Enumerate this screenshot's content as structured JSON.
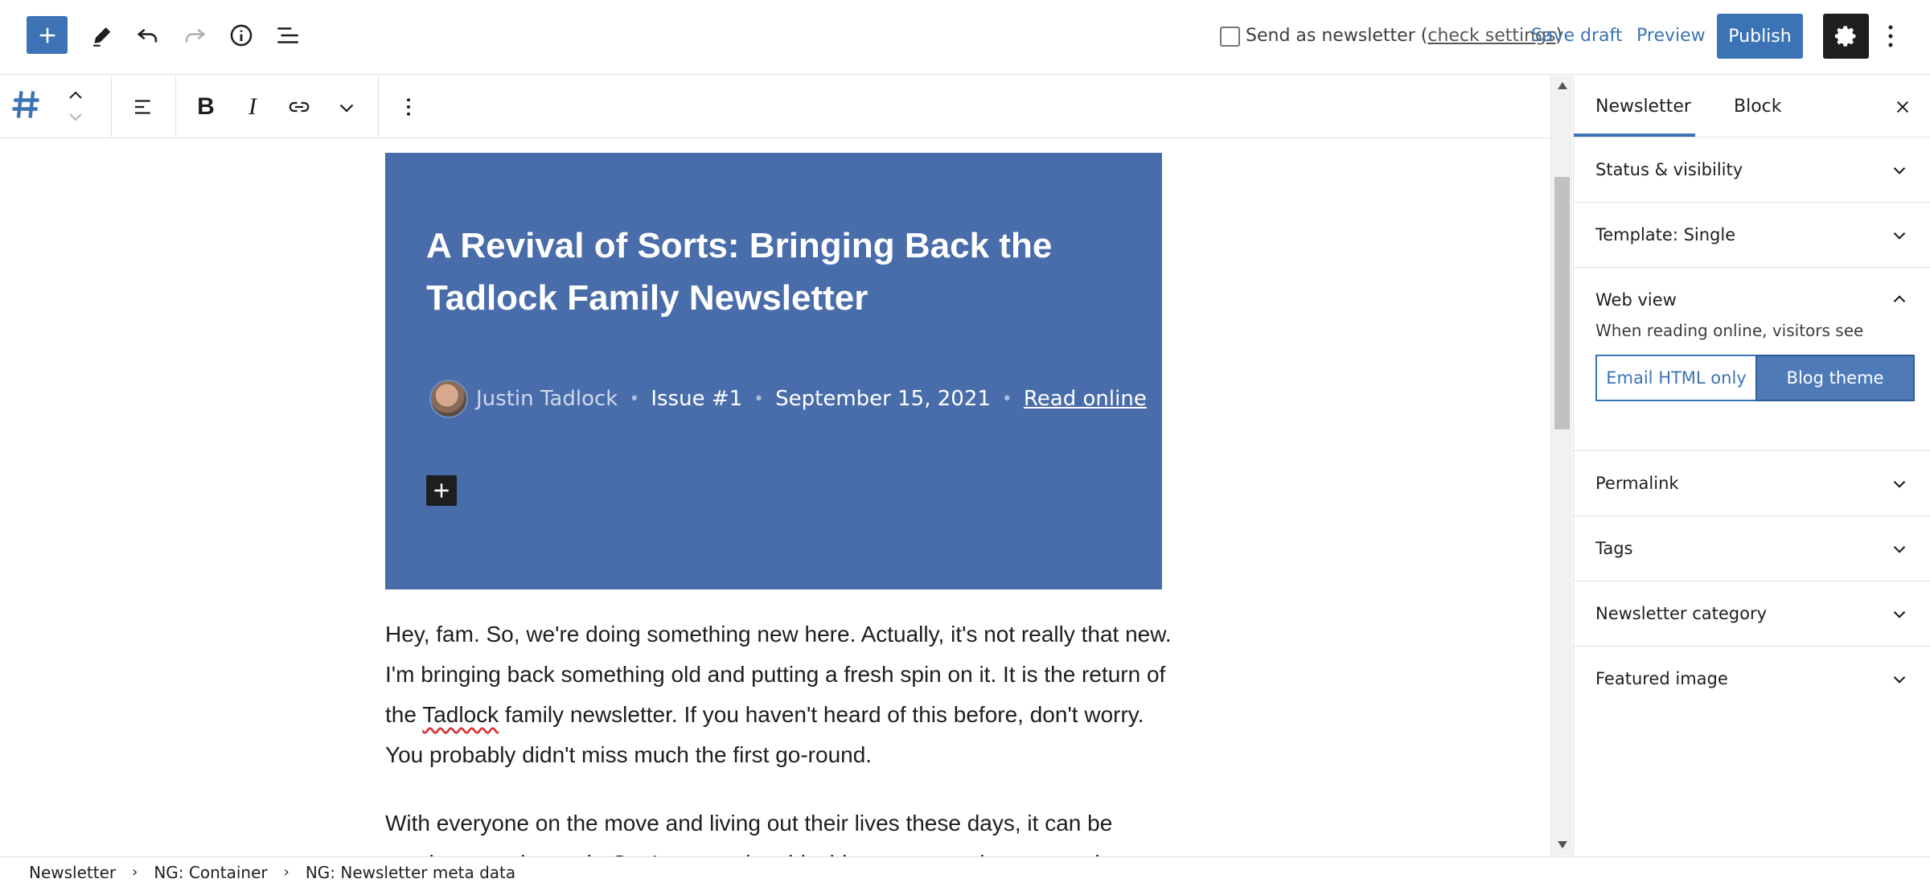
{
  "header": {
    "send_newsletter_label": "Send as newsletter",
    "check_settings_link": "check settings",
    "save_draft": "Save draft",
    "preview": "Preview",
    "publish": "Publish",
    "icons": [
      "plus-icon",
      "pencil-icon",
      "undo-icon",
      "redo-icon",
      "info-icon",
      "list-view-icon",
      "gear-icon",
      "more-vertical-icon"
    ]
  },
  "block_toolbar": {
    "icons": [
      "hash-icon",
      "move-up-icon",
      "move-down-icon",
      "align-left-icon",
      "bold-icon",
      "italic-icon",
      "link-icon",
      "chevron-down-icon",
      "more-vertical-icon"
    ],
    "bold_glyph": "B",
    "italic_glyph": "I"
  },
  "content": {
    "hero_title": "A Revival of Sorts: Bringing Back the Tadlock Family Newsletter",
    "author": "Justin Tadlock",
    "issue": "Issue #1",
    "date": "September 15, 2021",
    "read_online": "Read online",
    "separator": "•",
    "paragraph1_part1": "Hey, fam.  So, we're doing something new here.  Actually, it's not really that new.  I'm bringing back something old and putting a fresh spin on it.  It is the return of the ",
    "paragraph1_spell": "Tadlock",
    "paragraph1_part2": " family newsletter.  If you haven't heard of this before, don't worry.  You probably didn't miss much the first go-round.",
    "paragraph2": "With everyone on the move and living out their lives these days, it can be tough to stay in touch.  So, I am starting this thing as a way that we can keep",
    "hero_color": "#496caa"
  },
  "sidebar": {
    "tabs": [
      "Newsletter",
      "Block"
    ],
    "active_tab": "Newsletter",
    "panels": [
      {
        "title": "Status & visibility",
        "expanded": false
      },
      {
        "title": "Template: Single",
        "expanded": false
      },
      {
        "title": "Web view",
        "expanded": true
      },
      {
        "title": "Permalink",
        "expanded": false
      },
      {
        "title": "Tags",
        "expanded": false
      },
      {
        "title": "Newsletter category",
        "expanded": false
      },
      {
        "title": "Featured image",
        "expanded": false
      }
    ],
    "web_view": {
      "description": "When reading online, visitors see",
      "options": [
        "Email HTML only",
        "Blog theme"
      ],
      "selected": "Blog theme"
    }
  },
  "breadcrumb": [
    "Newsletter",
    "NG: Container",
    "NG: Newsletter meta data"
  ],
  "colors": {
    "accent": "#3c73b4",
    "dark": "#1e1e1e"
  }
}
